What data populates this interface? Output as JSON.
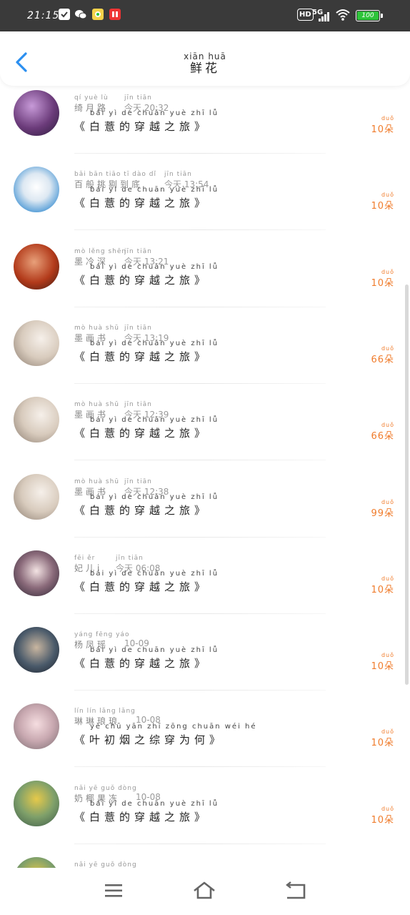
{
  "status_bar": {
    "time": "21:15",
    "network": "5G",
    "hd": "HD",
    "battery": "100"
  },
  "header": {
    "title_pinyin": "xiān huā",
    "title": "鲜花"
  },
  "rows": [
    {
      "name_pinyin": "qí yuè lù",
      "name": "绮月路",
      "time_pinyin": "jīn tiān",
      "time": "今天 20:32",
      "book_pinyin": "bái yì de chuān yuè zhī lǚ",
      "book": "《白薏的穿越之旅》",
      "count_pinyin": "duǒ",
      "count": "10朵"
    },
    {
      "name_pinyin": "bǎi bān tiāo tī dào dǐ",
      "name": "百般挑剔到底",
      "time_pinyin": "jīn tiān",
      "time": "今天 13:54",
      "book_pinyin": "bái yì de chuān yuè zhī lǚ",
      "book": "《白薏的穿越之旅》",
      "count_pinyin": "duǒ",
      "count": "10朵"
    },
    {
      "name_pinyin": "mò lěng shēn",
      "name": "墨冷深",
      "time_pinyin": "jīn tiān",
      "time": "今天 13:21",
      "book_pinyin": "bái yì de chuān yuè zhī lǚ",
      "book": "《白薏的穿越之旅》",
      "count_pinyin": "duǒ",
      "count": "10朵"
    },
    {
      "name_pinyin": "mò huà shū",
      "name": "墨画书",
      "time_pinyin": "jīn tiān",
      "time": "今天 13:19",
      "book_pinyin": "bái yì de chuān yuè zhī lǚ",
      "book": "《白薏的穿越之旅》",
      "count_pinyin": "duǒ",
      "count": "66朵"
    },
    {
      "name_pinyin": "mò huà shū",
      "name": "墨画书",
      "time_pinyin": "jīn tiān",
      "time": "今天 12:39",
      "book_pinyin": "bái yì de chuān yuè zhī lǚ",
      "book": "《白薏的穿越之旅》",
      "count_pinyin": "duǒ",
      "count": "66朵"
    },
    {
      "name_pinyin": "mò huà shū",
      "name": "墨画书",
      "time_pinyin": "jīn tiān",
      "time": "今天 12:38",
      "book_pinyin": "bái yì de chuān yuè zhī lǚ",
      "book": "《白薏的穿越之旅》",
      "count_pinyin": "duǒ",
      "count": "99朵"
    },
    {
      "name_pinyin": "fēi ěr",
      "name": "妃儿i",
      "time_pinyin": "jīn tiān",
      "time": "今天 06:08",
      "book_pinyin": "bái yì de chuān yuè zhī lǚ",
      "book": "《白薏的穿越之旅》",
      "count_pinyin": "duǒ",
      "count": "10朵"
    },
    {
      "name_pinyin": "yáng fēng yáo",
      "name": "杨凤瑶",
      "time_pinyin": "",
      "time": "10-09",
      "book_pinyin": "bái yì de chuān yuè zhī lǚ",
      "book": "《白薏的穿越之旅》",
      "count_pinyin": "duǒ",
      "count": "10朵"
    },
    {
      "name_pinyin": "lín lín lǎng lǎng",
      "name": "琳琳琅琅",
      "time_pinyin": "",
      "time": "10-08",
      "book_pinyin": "yè chū yān zhī zōng chuān wéi hé",
      "book": "《叶初烟之综穿为何》",
      "count_pinyin": "duǒ",
      "count": "10朵"
    },
    {
      "name_pinyin": "nǎi yē guǒ dòng",
      "name": "奶椰果冻",
      "time_pinyin": "",
      "time": "10-08",
      "book_pinyin": "bái yì de chuān yuè zhī lǚ",
      "book": "《白薏的穿越之旅》",
      "count_pinyin": "duǒ",
      "count": "10朵"
    },
    {
      "name_pinyin": "nǎi yē guǒ dòng",
      "name": "",
      "time_pinyin": "",
      "time": "",
      "book_pinyin": "",
      "book": "",
      "count_pinyin": "",
      "count": ""
    }
  ],
  "colors": {
    "accent": "#2b8ff0",
    "count": "#f07c2c",
    "status_bar": "#3a3a3a"
  },
  "icons": {
    "back": "chevron-left-icon",
    "menu": "menu-icon",
    "home": "home-icon",
    "return": "return-icon"
  }
}
